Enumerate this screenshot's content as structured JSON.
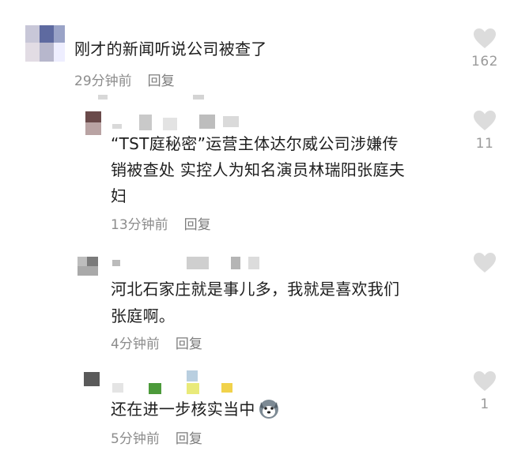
{
  "comments": [
    {
      "text": "刚才的新闻听说公司被查了",
      "time": "29分钟前",
      "reply": "回复",
      "likes": "162"
    },
    {
      "text_line1": "“TST庭秘密”运营主体达尔威公司涉嫌传",
      "text_line2": "销被查处 实控人为知名演员林瑞阳张庭夫",
      "text_line3": "妇",
      "time": "13分钟前",
      "reply": "回复",
      "likes": "11"
    },
    {
      "text_line1": "河北石家庄就是事儿多，我就是喜欢我们",
      "text_line2": "张庭啊。",
      "time": "4分钟前",
      "reply": "回复",
      "likes": ""
    },
    {
      "text": "还在进一步核实当中",
      "emoji": "husky-dog-emoji",
      "time": "5分钟前",
      "reply": "回复",
      "likes": "1"
    }
  ],
  "colors": {
    "like_icon": "#dcdcdc",
    "meta_text": "#8c8c8c"
  }
}
